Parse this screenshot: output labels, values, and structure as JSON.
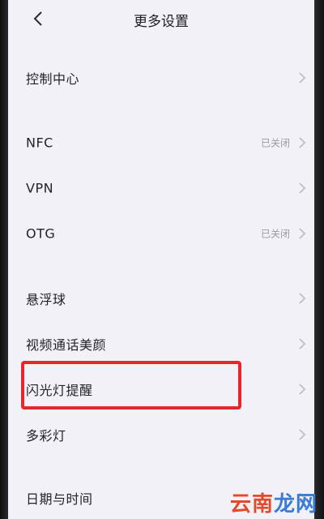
{
  "header": {
    "title": "更多设置",
    "back_icon": "chevron-left-icon"
  },
  "rows": [
    {
      "label": "控制中心",
      "value": ""
    },
    {
      "label": "NFC",
      "value": "已关闭"
    },
    {
      "label": "VPN",
      "value": ""
    },
    {
      "label": "OTG",
      "value": "已关闭"
    },
    {
      "label": "悬浮球",
      "value": ""
    },
    {
      "label": "视频通话美颜",
      "value": ""
    },
    {
      "label": "闪光灯提醒",
      "value": ""
    },
    {
      "label": "多彩灯",
      "value": ""
    },
    {
      "label": "日期与时间",
      "value": ""
    }
  ],
  "highlight": {
    "target": "闪光灯提醒",
    "color": "#e8262b"
  },
  "watermark": {
    "part1": "云南",
    "part2": "龙网"
  }
}
